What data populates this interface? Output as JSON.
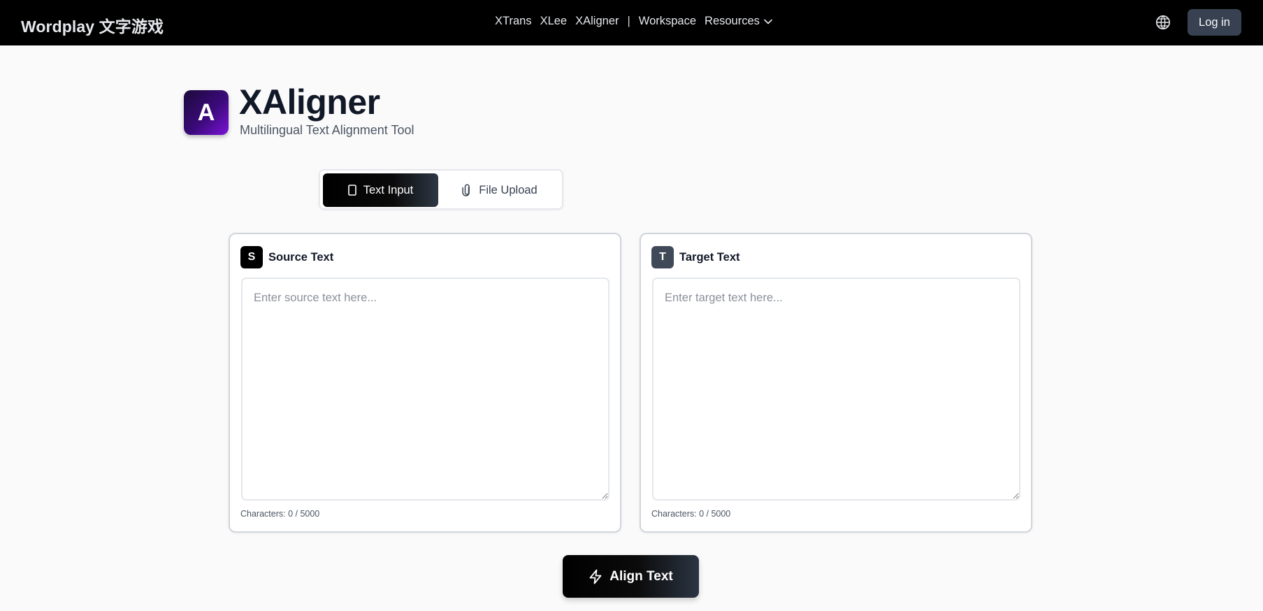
{
  "nav": {
    "brand": "Wordplay 文字游戏",
    "links": {
      "xtrans": "XTrans",
      "xlee": "XLee",
      "xaligner": "XAligner",
      "separator": "|",
      "workspace": "Workspace",
      "resources": "Resources"
    },
    "icons": {
      "language": "globe-icon",
      "resources_dropdown": "chevron-down-icon"
    },
    "login_label": "Log in"
  },
  "header": {
    "logo_letter": "A",
    "title": "XAligner",
    "subtitle": "Multilingual Text Alignment Tool"
  },
  "mode_toggle": {
    "text_input_label": "Text Input",
    "file_upload_label": "File Upload",
    "active": "text_input",
    "icons": {
      "text_input": "document-icon",
      "file_upload": "paperclip-icon"
    }
  },
  "source_panel": {
    "badge": "S",
    "title": "Source Text",
    "placeholder": "Enter source text here...",
    "value": "",
    "char_count": "Characters: 0 / 5000"
  },
  "target_panel": {
    "badge": "T",
    "title": "Target Text",
    "placeholder": "Enter target text here...",
    "value": "",
    "char_count": "Characters: 0 / 5000"
  },
  "actions": {
    "align_label": "Align Text",
    "align_icon": "lightning-icon"
  },
  "colors": {
    "navbar_bg": "#000000",
    "page_bg": "#fafafa",
    "login_bg": "#374151",
    "logo_gradient_start": "#1b0a3a",
    "logo_gradient_end": "#7c13d8",
    "target_badge_bg": "#3f4957"
  }
}
